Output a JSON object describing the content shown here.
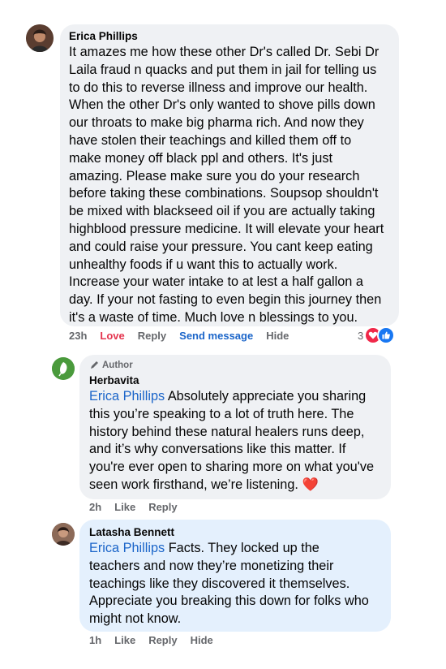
{
  "comments": [
    {
      "author": "Erica Phillips",
      "text": "It amazes me how these other Dr's called Dr. Sebi Dr\nLaila fraud n quacks and put them in jail for telling us\nto do this to reverse illness and improve our health.\nWhen the other Dr's only wanted to shove pills down\nour throats to make big pharma rich. And now they\nhave stolen their teachings and killed them off to\nmake money off black ppl and others. It's just\namazing. Please make sure you do your research\nbefore taking these combinations. Soupsop shouldn't\nbe mixed with blackseed oil if you are actually taking\nhighblood pressure medicine. It will elevate your heart\nand could raise your pressure. You cant keep eating\nunhealthy foods if u want this to actually work.\nIncrease your water intake to at lest a half gallon a\nday. If your not fasting to even begin this journey then\nit's a waste of time. Much love n blessings to you.",
      "time": "23h",
      "love_label": "Love",
      "reply_label": "Reply",
      "send_label": "Send message",
      "hide_label": "Hide",
      "reaction_count": "3",
      "reaction_icons": [
        "heart-icon",
        "like-icon"
      ]
    },
    {
      "author_tag": "Author",
      "author": "Herbavita",
      "mention": "Erica Phillips",
      "text": " Absolutely appreciate you sharing\nthis you’re speaking to a lot of truth here. The\nhistory behind these natural healers runs deep,\nand it’s why conversations like this matter. If\nyou're ever open to sharing more on what you've\nseen work firsthand, we’re listening. ",
      "emoji": "❤️",
      "time": "2h",
      "like_label": "Like",
      "reply_label": "Reply"
    },
    {
      "author": "Latasha Bennett",
      "mention": "Erica Phillips",
      "text": " Facts. They locked up the\nteachers and now they’re monetizing their\nteachings like they discovered it themselves.\nAppreciate you breaking this down for folks who\nmight not know.",
      "time": "1h",
      "like_label": "Like",
      "reply_label": "Reply",
      "hide_label": "Hide"
    }
  ],
  "colors": {
    "bubble": "#eff1f4",
    "highlight_bubble": "#e4f0fd",
    "mention": "#1b65c9",
    "love": "#e4344e",
    "meta": "#65676b"
  }
}
